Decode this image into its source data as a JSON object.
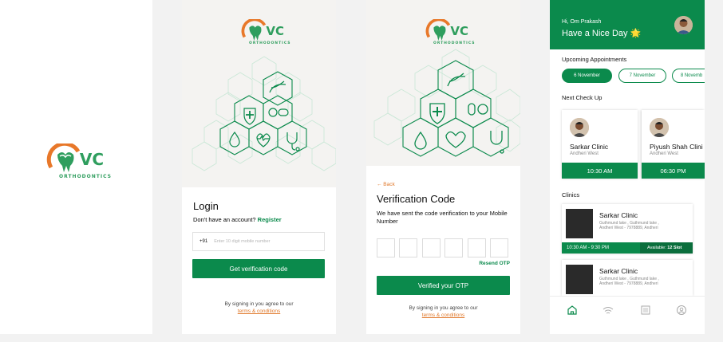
{
  "brand": {
    "logo_letters": "VC",
    "logo_sub": "ORTHODONTICS"
  },
  "login": {
    "title": "Login",
    "no_account": "Don't have an account?",
    "register": "Register",
    "country_code": "+91",
    "phone_placeholder": "Enter 10 digit mobile number",
    "button": "Get verification code",
    "terms_prefix": "By signing in you agree to our",
    "terms_link": "terms & conditions"
  },
  "verify": {
    "back": "← Back",
    "title": "Verification Code",
    "subtitle": "We have sent the code verification to your Mobile Number",
    "resend": "Resend OTP",
    "button": "Verified your OTP",
    "terms_prefix": "By signing in you agree to our",
    "terms_link": "terms & conditions"
  },
  "home": {
    "greeting": "Hi, Om Prakash",
    "headline": "Have a Nice Day 🌟",
    "upcoming_title": "Upcoming Appointments",
    "dates": [
      "6 November",
      "7 November",
      "8 Novemb"
    ],
    "next_checkup_title": "Next Check Up",
    "checkups": [
      {
        "name": "Sarkar Clinic",
        "area": "Andheri West",
        "time": "10:30 AM"
      },
      {
        "name": "Piyush Shah Clini",
        "area": "Andheri West",
        "time": "06:30 PM"
      }
    ],
    "clinics_title": "Clinics",
    "clinics": [
      {
        "name": "Sarkar Clinic",
        "line1": "Guthmund lake , Guthmund lake ,",
        "line2": "Andheri West - 7978889, Andheri",
        "hours": "10:30 AM - 9:30 PM",
        "slots_label": "Available:",
        "slots_value": "12 Slot"
      },
      {
        "name": "Sarkar Clinic",
        "line1": "Guthmund lake , Guthmund lake ,",
        "line2": "Andheri West - 7978889, Andheri"
      }
    ]
  },
  "colors": {
    "primary": "#0b8a4c",
    "accent": "#e0782a"
  }
}
